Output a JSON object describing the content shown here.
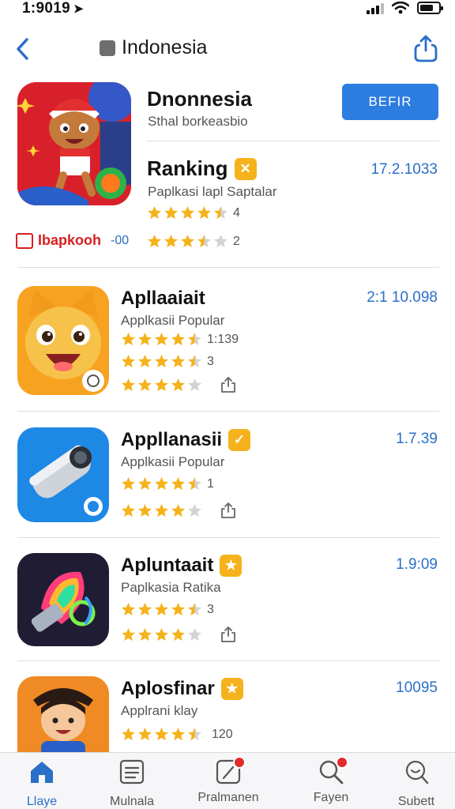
{
  "status_bar": {
    "time": "1:9019"
  },
  "nav": {
    "title": "Indonesia"
  },
  "featured": {
    "name": "Dnonnesia",
    "subtitle": "Sthal borkeasbio",
    "get_label": "BEFIR",
    "ranking": {
      "title": "Ranking",
      "date": "17.2.1033",
      "subtitle": "Paplkasi lapl Saptalar",
      "rating1": {
        "stars": 4.5,
        "value": "4"
      },
      "rating2": {
        "stars": 3.5,
        "value": "2"
      }
    },
    "brand": {
      "name": "Ibapkooh",
      "number": "-00"
    }
  },
  "apps": [
    {
      "name": "Apllaaiait",
      "date": "2:1 10.098",
      "subtitle": "Applkasii Popular",
      "badge": false,
      "icon": "cat-icon",
      "ratings": [
        {
          "stars": 4.5,
          "value": "1:139"
        },
        {
          "stars": 4.5,
          "value": "3"
        },
        {
          "stars": 4,
          "value": "",
          "share": true
        }
      ]
    },
    {
      "name": "Appllanasii",
      "date": "1.7.39",
      "subtitle": "Applkasii Popular",
      "badge": true,
      "icon": "camera-icon",
      "ratings": [
        {
          "stars": 4.5,
          "value": "1"
        },
        {
          "stars": 4,
          "value": "",
          "share": true
        }
      ]
    },
    {
      "name": "Apluntaait",
      "date": "1.9:09",
      "subtitle": "Paplkasia Ratika",
      "badge": true,
      "icon": "rocket-icon",
      "ratings": [
        {
          "stars": 4.5,
          "value": "3"
        },
        {
          "stars": 4,
          "value": "",
          "share": true
        }
      ]
    },
    {
      "name": "Aplosfinar",
      "date": "10095",
      "subtitle": "Applrani klay",
      "badge": true,
      "icon": "character-icon",
      "ratings": [
        {
          "stars": 4.5,
          "value": "120"
        }
      ]
    }
  ],
  "tabs": [
    {
      "label": "Llaye",
      "icon": "home-icon",
      "active": true
    },
    {
      "label": "Mulnala",
      "icon": "list-icon",
      "active": false
    },
    {
      "label": "Pralmanen",
      "icon": "clock-icon",
      "active": false
    },
    {
      "label": "Fayen",
      "icon": "search-icon",
      "active": false
    },
    {
      "label": "Subett",
      "icon": "profile-icon",
      "active": false
    }
  ],
  "colors": {
    "accent": "#2a6fc9",
    "button": "#2d7ce0",
    "star": "#f5b21a",
    "badge": "#f6b21c",
    "notification": "#e02b2b"
  }
}
